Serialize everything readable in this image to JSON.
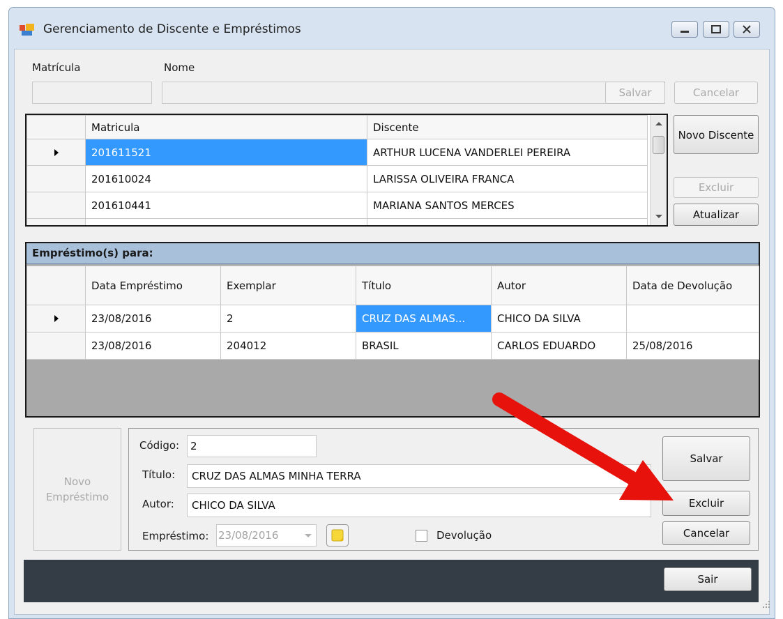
{
  "window": {
    "title": "Gerenciamento de Discente e Empréstimos"
  },
  "header": {
    "matricula_label": "Matrícula",
    "nome_label": "Nome",
    "salvar_label": "Salvar",
    "cancelar_label": "Cancelar"
  },
  "students": {
    "columns": [
      "Matricula",
      "Discente"
    ],
    "rows": [
      {
        "matricula": "201611521",
        "discente": "ARTHUR LUCENA VANDERLEI PEREIRA"
      },
      {
        "matricula": "201610024",
        "discente": "LARISSA OLIVEIRA FRANCA"
      },
      {
        "matricula": "201610441",
        "discente": "MARIANA SANTOS MERCES"
      }
    ]
  },
  "side_buttons": {
    "novo_discente": "Novo Discente",
    "excluir": "Excluir",
    "atualizar": "Atualizar"
  },
  "loans": {
    "header": "Empréstimo(s) para:",
    "columns": [
      "Data Empréstimo",
      "Exemplar",
      "Título",
      "Autor",
      "Data de Devolução"
    ],
    "rows": [
      {
        "data": "23/08/2016",
        "exemplar": "2",
        "titulo": "CRUZ DAS ALMAS...",
        "autor": "CHICO DA SILVA",
        "devolucao": ""
      },
      {
        "data": "23/08/2016",
        "exemplar": "204012",
        "titulo": "BRASIL",
        "autor": "CARLOS EDUARDO",
        "devolucao": "25/08/2016"
      }
    ]
  },
  "form": {
    "novo_emprestimo": "Novo Empréstimo",
    "codigo_label": "Código:",
    "codigo_value": "2",
    "titulo_label": "Título:",
    "titulo_value": "CRUZ DAS ALMAS MINHA TERRA",
    "autor_label": "Autor:",
    "autor_value": "CHICO DA SILVA",
    "emprestimo_label": "Empréstimo:",
    "emprestimo_value": "23/08/2016",
    "devolucao_label": "Devolução",
    "salvar": "Salvar",
    "excluir": "Excluir",
    "cancelar": "Cancelar"
  },
  "footer": {
    "sair": "Sair"
  },
  "colors": {
    "selection": "#3399ff",
    "section_header": "#a9c0da",
    "footer": "#343c45",
    "arrow": "#e8120c"
  }
}
